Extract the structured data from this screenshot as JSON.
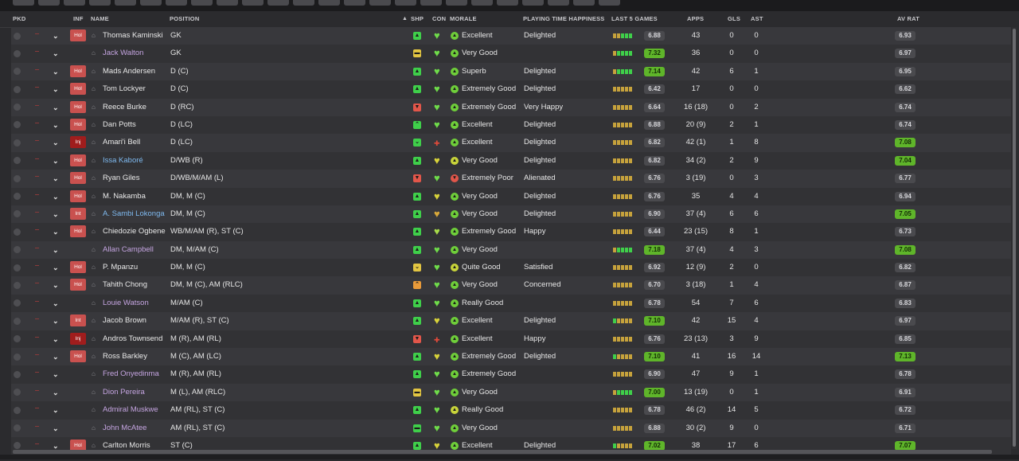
{
  "colors": {
    "bg": "#2b2b2e",
    "row_odd": "#38383c",
    "row_even": "#323235",
    "accent_green": "#5fb52a",
    "hol_badge": "#c9514f",
    "inj_badge": "#a01d1d",
    "name_purple": "#c4a4e0",
    "name_blue": "#7fbaf0"
  },
  "header": {
    "pkd": "PKD",
    "inf": "INF",
    "name": "NAME",
    "position": "POSITION",
    "shp": "SHP",
    "con": "CON",
    "morale": "MORALE",
    "playing_time": "PLAYING TIME HAPPINESS",
    "last5": "LAST 5 GAMES",
    "apps": "APPS",
    "gls": "GLS",
    "ast": "AST",
    "av_rat": "AV RAT"
  },
  "players": [
    {
      "inf": "Hol",
      "name": "Thomas Kaminski",
      "name_color": "white",
      "position": "GK",
      "shp": "up",
      "shp_color": "#3fcf4a",
      "con": "#6fdc4a",
      "con_icon": "heart",
      "morale_icon": "#6fcf3a",
      "morale": "Excellent",
      "happiness": "Delighted",
      "bars": [
        "#c6a23c",
        "#c6a23c",
        "#3fcf4a",
        "#3fcf4a",
        "#3fcf4a"
      ],
      "last5": "6.88",
      "last5_good": false,
      "apps": "43",
      "gls": "0",
      "ast": "0",
      "av": "6.93",
      "av_good": false
    },
    {
      "inf": "",
      "name": "Jack Walton",
      "name_color": "purple",
      "position": "GK",
      "shp": "same",
      "shp_color": "#e2c542",
      "con": "#6fdc4a",
      "con_icon": "heart",
      "morale_icon": "#6fcf3a",
      "morale": "Very Good",
      "happiness": "",
      "bars": [
        "#c6a23c",
        "#3fcf4a",
        "#3fcf4a",
        "#3fcf4a",
        "#3fcf4a"
      ],
      "last5": "7.32",
      "last5_good": true,
      "apps": "36",
      "gls": "0",
      "ast": "0",
      "av": "6.97",
      "av_good": false
    },
    {
      "inf": "Hol",
      "name": "Mads Andersen",
      "name_color": "white",
      "position": "D (C)",
      "shp": "up",
      "shp_color": "#3fcf4a",
      "con": "#6fdc4a",
      "con_icon": "heart",
      "morale_icon": "#6fcf3a",
      "morale": "Superb",
      "happiness": "Delighted",
      "bars": [
        "#c6a23c",
        "#3fcf4a",
        "#3fcf4a",
        "#3fcf4a",
        "#3fcf4a"
      ],
      "last5": "7.14",
      "last5_good": true,
      "apps": "42",
      "gls": "6",
      "ast": "1",
      "av": "6.95",
      "av_good": false
    },
    {
      "inf": "Hol",
      "name": "Tom Lockyer",
      "name_color": "white",
      "position": "D (C)",
      "shp": "up",
      "shp_color": "#3fcf4a",
      "con": "#6fdc4a",
      "con_icon": "heart",
      "morale_icon": "#6fcf3a",
      "morale": "Extremely Good",
      "happiness": "Delighted",
      "bars": [
        "#c6a23c",
        "#c6a23c",
        "#c6a23c",
        "#c6a23c",
        "#c6a23c"
      ],
      "last5": "6.42",
      "last5_good": false,
      "apps": "17",
      "gls": "0",
      "ast": "0",
      "av": "6.62",
      "av_good": false
    },
    {
      "inf": "Hol",
      "name": "Reece Burke",
      "name_color": "white",
      "position": "D (RC)",
      "shp": "down",
      "shp_color": "#e2564a",
      "con": "#6fdc4a",
      "con_icon": "heart",
      "morale_icon": "#6fcf3a",
      "morale": "Extremely Good",
      "happiness": "Very Happy",
      "bars": [
        "#c6a23c",
        "#c6a23c",
        "#c6a23c",
        "#c6a23c",
        "#c6a23c"
      ],
      "last5": "6.64",
      "last5_good": false,
      "apps": "16 (18)",
      "gls": "0",
      "ast": "2",
      "av": "6.74",
      "av_good": false
    },
    {
      "inf": "Hol",
      "name": "Dan Potts",
      "name_color": "white",
      "position": "D (LC)",
      "shp": "up2",
      "shp_color": "#3fcf4a",
      "con": "#6fdc4a",
      "con_icon": "heart",
      "morale_icon": "#6fcf3a",
      "morale": "Excellent",
      "happiness": "Delighted",
      "bars": [
        "#c6a23c",
        "#c6a23c",
        "#c6a23c",
        "#c6a23c",
        "#c6a23c"
      ],
      "last5": "6.88",
      "last5_good": false,
      "apps": "20 (9)",
      "gls": "2",
      "ast": "1",
      "av": "6.74",
      "av_good": false
    },
    {
      "inf": "Inj",
      "name": "Amari'i Bell",
      "name_color": "white",
      "position": "D (LC)",
      "shp": "down2",
      "shp_color": "#3fcf4a",
      "con": "#e24a3a",
      "con_icon": "inj",
      "morale_icon": "#6fcf3a",
      "morale": "Excellent",
      "happiness": "Delighted",
      "bars": [
        "#c6a23c",
        "#c6a23c",
        "#c6a23c",
        "#c6a23c",
        "#c6a23c"
      ],
      "last5": "6.82",
      "last5_good": false,
      "apps": "42 (1)",
      "gls": "1",
      "ast": "8",
      "av": "7.08",
      "av_good": true
    },
    {
      "inf": "Hol",
      "name": "Issa Kaboré",
      "name_color": "blue",
      "position": "D/WB (R)",
      "shp": "up",
      "shp_color": "#3fcf4a",
      "con": "#d8d33a",
      "con_icon": "heart",
      "morale_icon": "#c8d43a",
      "morale": "Very Good",
      "happiness": "Delighted",
      "bars": [
        "#c6a23c",
        "#c6a23c",
        "#c6a23c",
        "#c6a23c",
        "#c6a23c"
      ],
      "last5": "6.82",
      "last5_good": false,
      "apps": "34 (2)",
      "gls": "2",
      "ast": "9",
      "av": "7.04",
      "av_good": true
    },
    {
      "inf": "Hol",
      "name": "Ryan Giles",
      "name_color": "white",
      "position": "D/WB/M/AM (L)",
      "shp": "down",
      "shp_color": "#e2564a",
      "con": "#6fdc4a",
      "con_icon": "heart",
      "morale_icon": "#e2564a",
      "morale": "Extremely Poor",
      "happiness": "Alienated",
      "bars": [
        "#c6a23c",
        "#c6a23c",
        "#c6a23c",
        "#c6a23c",
        "#c6a23c"
      ],
      "last5": "6.76",
      "last5_good": false,
      "apps": "3 (19)",
      "gls": "0",
      "ast": "3",
      "av": "6.77",
      "av_good": false
    },
    {
      "inf": "Hol",
      "name": "M. Nakamba",
      "name_color": "white",
      "position": "DM, M (C)",
      "shp": "up",
      "shp_color": "#3fcf4a",
      "con": "#d8d33a",
      "con_icon": "heart",
      "morale_icon": "#6fcf3a",
      "morale": "Very Good",
      "happiness": "Delighted",
      "bars": [
        "#c6a23c",
        "#c6a23c",
        "#c6a23c",
        "#c6a23c",
        "#c6a23c"
      ],
      "last5": "6.76",
      "last5_good": false,
      "apps": "35",
      "gls": "4",
      "ast": "4",
      "av": "6.94",
      "av_good": false
    },
    {
      "inf": "Int",
      "name": "A. Sambi Lokonga",
      "name_color": "blue",
      "position": "DM, M (C)",
      "shp": "up",
      "shp_color": "#3fcf4a",
      "con": "#d8a83a",
      "con_icon": "heart",
      "morale_icon": "#6fcf3a",
      "morale": "Very Good",
      "happiness": "Delighted",
      "bars": [
        "#c6a23c",
        "#c6a23c",
        "#c6a23c",
        "#c6a23c",
        "#c6a23c"
      ],
      "last5": "6.90",
      "last5_good": false,
      "apps": "37 (4)",
      "gls": "6",
      "ast": "6",
      "av": "7.05",
      "av_good": true
    },
    {
      "inf": "Hol",
      "name": "Chiedozie Ogbene",
      "name_color": "white",
      "position": "WB/M/AM (R), ST (C)",
      "shp": "up",
      "shp_color": "#3fcf4a",
      "con": "#a8dc4a",
      "con_icon": "heart",
      "morale_icon": "#6fcf3a",
      "morale": "Extremely Good",
      "happiness": "Happy",
      "bars": [
        "#c6a23c",
        "#c6a23c",
        "#c6a23c",
        "#c6a23c",
        "#c6a23c"
      ],
      "last5": "6.44",
      "last5_good": false,
      "apps": "23 (15)",
      "gls": "8",
      "ast": "1",
      "av": "6.73",
      "av_good": false
    },
    {
      "inf": "",
      "name": "Allan Campbell",
      "name_color": "purple",
      "position": "DM, M/AM (C)",
      "shp": "up",
      "shp_color": "#3fcf4a",
      "con": "#6fdc4a",
      "con_icon": "heart",
      "morale_icon": "#6fcf3a",
      "morale": "Very Good",
      "happiness": "",
      "bars": [
        "#c6a23c",
        "#3fcf4a",
        "#3fcf4a",
        "#3fcf4a",
        "#3fcf4a"
      ],
      "last5": "7.18",
      "last5_good": true,
      "apps": "37 (4)",
      "gls": "4",
      "ast": "3",
      "av": "7.08",
      "av_good": true
    },
    {
      "inf": "Hol",
      "name": "P. Mpanzu",
      "name_color": "white",
      "position": "DM, M (C)",
      "shp": "down2",
      "shp_color": "#e2c542",
      "con": "#6fdc4a",
      "con_icon": "heart",
      "morale_icon": "#c8d43a",
      "morale": "Quite Good",
      "happiness": "Satisfied",
      "bars": [
        "#c6a23c",
        "#c6a23c",
        "#c6a23c",
        "#c6a23c",
        "#c6a23c"
      ],
      "last5": "6.92",
      "last5_good": false,
      "apps": "12 (9)",
      "gls": "2",
      "ast": "0",
      "av": "6.82",
      "av_good": false
    },
    {
      "inf": "Hol",
      "name": "Tahith Chong",
      "name_color": "white",
      "position": "DM, M (C), AM (RLC)",
      "shp": "up2",
      "shp_color": "#e89a3a",
      "con": "#6fdc4a",
      "con_icon": "heart",
      "morale_icon": "#6fcf3a",
      "morale": "Very Good",
      "happiness": "Concerned",
      "bars": [
        "#c6a23c",
        "#c6a23c",
        "#c6a23c",
        "#c6a23c",
        "#c6a23c"
      ],
      "last5": "6.70",
      "last5_good": false,
      "apps": "3 (18)",
      "gls": "1",
      "ast": "4",
      "av": "6.87",
      "av_good": false
    },
    {
      "inf": "",
      "name": "Louie Watson",
      "name_color": "purple",
      "position": "M/AM (C)",
      "shp": "up",
      "shp_color": "#3fcf4a",
      "con": "#6fdc4a",
      "con_icon": "heart",
      "morale_icon": "#6fcf3a",
      "morale": "Really Good",
      "happiness": "",
      "bars": [
        "#c6a23c",
        "#c6a23c",
        "#c6a23c",
        "#c6a23c",
        "#c6a23c"
      ],
      "last5": "6.78",
      "last5_good": false,
      "apps": "54",
      "gls": "7",
      "ast": "6",
      "av": "6.83",
      "av_good": false
    },
    {
      "inf": "Int",
      "name": "Jacob Brown",
      "name_color": "white",
      "position": "M/AM (R), ST (C)",
      "shp": "up",
      "shp_color": "#3fcf4a",
      "con": "#d8d33a",
      "con_icon": "heart",
      "morale_icon": "#6fcf3a",
      "morale": "Excellent",
      "happiness": "Delighted",
      "bars": [
        "#3fcf4a",
        "#c6a23c",
        "#c6a23c",
        "#c6a23c",
        "#c6a23c"
      ],
      "last5": "7.10",
      "last5_good": true,
      "apps": "42",
      "gls": "15",
      "ast": "4",
      "av": "6.97",
      "av_good": false
    },
    {
      "inf": "Inj",
      "name": "Andros Townsend",
      "name_color": "white",
      "position": "M (R), AM (RL)",
      "shp": "down",
      "shp_color": "#e2564a",
      "con": "#e24a3a",
      "con_icon": "inj",
      "morale_icon": "#6fcf3a",
      "morale": "Excellent",
      "happiness": "Happy",
      "bars": [
        "#c6a23c",
        "#c6a23c",
        "#c6a23c",
        "#c6a23c",
        "#c6a23c"
      ],
      "last5": "6.76",
      "last5_good": false,
      "apps": "23 (13)",
      "gls": "3",
      "ast": "9",
      "av": "6.85",
      "av_good": false
    },
    {
      "inf": "Hol",
      "name": "Ross Barkley",
      "name_color": "white",
      "position": "M (C), AM (LC)",
      "shp": "up",
      "shp_color": "#3fcf4a",
      "con": "#d8d33a",
      "con_icon": "heart",
      "morale_icon": "#6fcf3a",
      "morale": "Extremely Good",
      "happiness": "Delighted",
      "bars": [
        "#3fcf4a",
        "#c6a23c",
        "#c6a23c",
        "#c6a23c",
        "#c6a23c"
      ],
      "last5": "7.10",
      "last5_good": true,
      "apps": "41",
      "gls": "16",
      "ast": "14",
      "av": "7.13",
      "av_good": true
    },
    {
      "inf": "",
      "name": "Fred Onyedinma",
      "name_color": "purple",
      "position": "M (R), AM (RL)",
      "shp": "up",
      "shp_color": "#3fcf4a",
      "con": "#6fdc4a",
      "con_icon": "heart",
      "morale_icon": "#6fcf3a",
      "morale": "Extremely Good",
      "happiness": "",
      "bars": [
        "#c6a23c",
        "#c6a23c",
        "#c6a23c",
        "#c6a23c",
        "#c6a23c"
      ],
      "last5": "6.90",
      "last5_good": false,
      "apps": "47",
      "gls": "9",
      "ast": "1",
      "av": "6.78",
      "av_good": false
    },
    {
      "inf": "",
      "name": "Dion Pereira",
      "name_color": "purple",
      "position": "M (L), AM (RLC)",
      "shp": "same",
      "shp_color": "#e2c542",
      "con": "#6fdc4a",
      "con_icon": "heart",
      "morale_icon": "#6fcf3a",
      "morale": "Very Good",
      "happiness": "",
      "bars": [
        "#c6a23c",
        "#3fcf4a",
        "#3fcf4a",
        "#3fcf4a",
        "#3fcf4a"
      ],
      "last5": "7.00",
      "last5_good": true,
      "apps": "13 (19)",
      "gls": "0",
      "ast": "1",
      "av": "6.91",
      "av_good": false
    },
    {
      "inf": "",
      "name": "Admiral Muskwe",
      "name_color": "purple",
      "position": "AM (RL), ST (C)",
      "shp": "up",
      "shp_color": "#3fcf4a",
      "con": "#6fdc4a",
      "con_icon": "heart",
      "morale_icon": "#c8d43a",
      "morale": "Really Good",
      "happiness": "",
      "bars": [
        "#c6a23c",
        "#c6a23c",
        "#c6a23c",
        "#c6a23c",
        "#c6a23c"
      ],
      "last5": "6.78",
      "last5_good": false,
      "apps": "46 (2)",
      "gls": "14",
      "ast": "5",
      "av": "6.72",
      "av_good": false
    },
    {
      "inf": "",
      "name": "John McAtee",
      "name_color": "purple",
      "position": "AM (RL), ST (C)",
      "shp": "same",
      "shp_color": "#3fcf4a",
      "con": "#6fdc4a",
      "con_icon": "heart",
      "morale_icon": "#6fcf3a",
      "morale": "Very Good",
      "happiness": "",
      "bars": [
        "#c6a23c",
        "#c6a23c",
        "#c6a23c",
        "#c6a23c",
        "#c6a23c"
      ],
      "last5": "6.88",
      "last5_good": false,
      "apps": "30 (2)",
      "gls": "9",
      "ast": "0",
      "av": "6.71",
      "av_good": false
    },
    {
      "inf": "Hol",
      "name": "Carlton Morris",
      "name_color": "white",
      "position": "ST (C)",
      "shp": "up",
      "shp_color": "#3fcf4a",
      "con": "#d8d33a",
      "con_icon": "heart",
      "morale_icon": "#6fcf3a",
      "morale": "Excellent",
      "happiness": "Delighted",
      "bars": [
        "#3fcf4a",
        "#c6a23c",
        "#c6a23c",
        "#c6a23c",
        "#c6a23c"
      ],
      "last5": "7.02",
      "last5_good": true,
      "apps": "38",
      "gls": "17",
      "ast": "6",
      "av": "7.07",
      "av_good": true
    }
  ]
}
